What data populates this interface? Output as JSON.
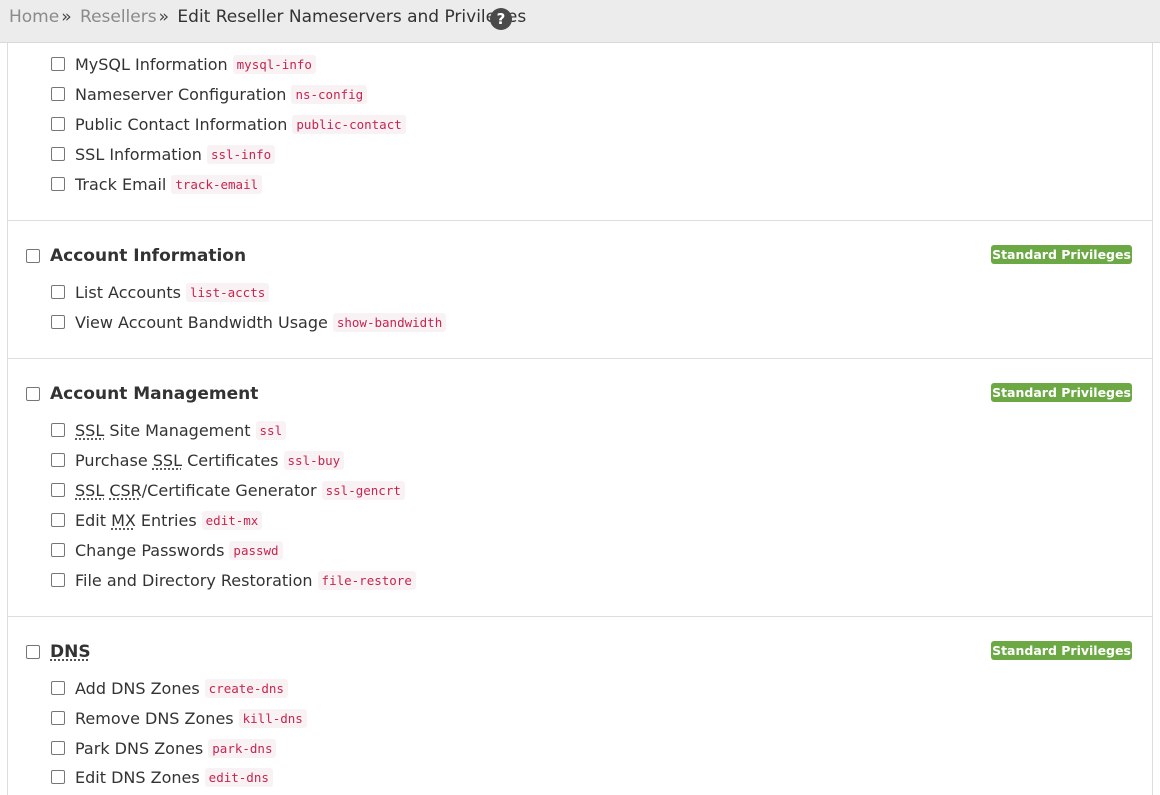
{
  "breadcrumb": {
    "home": "Home",
    "separator": "»",
    "resellers": "Resellers",
    "current": "Edit Reseller Nameservers and Privileges",
    "help_icon": "question-circle-icon"
  },
  "top_section": {
    "items": [
      {
        "label": "MySQL Information",
        "code": "mysql-info"
      },
      {
        "label": "Nameserver Configuration",
        "code": "ns-config"
      },
      {
        "label": "Public Contact Information",
        "code": "public-contact"
      },
      {
        "label": "SSL Information",
        "code": "ssl-info"
      },
      {
        "label": "Track Email",
        "code": "track-email"
      }
    ]
  },
  "sections": [
    {
      "title": "Account Information",
      "badge": "Standard Privileges",
      "items": [
        {
          "label": "List Accounts",
          "code": "list-accts"
        },
        {
          "label": "View Account Bandwidth Usage",
          "code": "show-bandwidth"
        }
      ]
    },
    {
      "title": "Account Management",
      "badge": "Standard Privileges",
      "items": [
        {
          "label_abbr": "SSL",
          "label_rest": " Site Management",
          "code": "ssl"
        },
        {
          "label_pre": "Purchase ",
          "label_abbr": "SSL",
          "label_rest": " Certificates",
          "code": "ssl-buy"
        },
        {
          "label_abbr": "SSL",
          "label_abbr2": "CSR",
          "label_rest": "/Certificate Generator",
          "code": "ssl-gencrt"
        },
        {
          "label_pre": "Edit ",
          "label_abbr": "MX",
          "label_rest": " Entries",
          "code": "edit-mx"
        },
        {
          "label": "Change Passwords",
          "code": "passwd"
        },
        {
          "label": "File and Directory Restoration",
          "code": "file-restore"
        }
      ]
    },
    {
      "title": "DNS",
      "badge": "Standard Privileges",
      "items": [
        {
          "label": "Add DNS Zones",
          "code": "create-dns"
        },
        {
          "label": "Remove DNS Zones",
          "code": "kill-dns"
        },
        {
          "label": "Park DNS Zones",
          "code": "park-dns"
        },
        {
          "label": "Edit DNS Zones",
          "code": "edit-dns"
        }
      ]
    }
  ],
  "colors": {
    "badge": "#6ca945",
    "code_text": "#c7254e",
    "code_bg": "#f9f2f4",
    "topbar_bg": "#ececec"
  }
}
